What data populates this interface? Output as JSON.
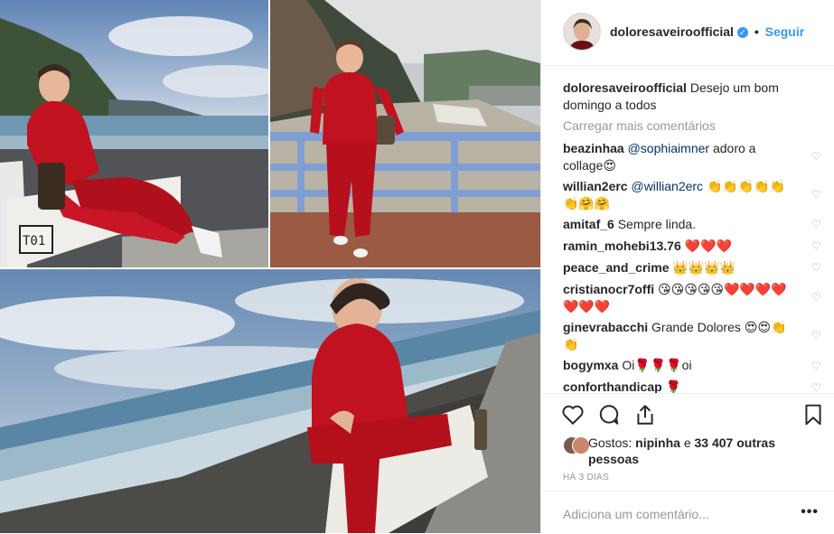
{
  "post": {
    "username": "doloresaveiroofficial",
    "verified_icon": "verified-badge-icon",
    "separator": "•",
    "follow_label": "Seguir",
    "caption_user": "doloresaveiroofficial",
    "caption_text": "Desejo um bom domingo a todos",
    "load_more": "Carregar mais comentários",
    "photo_sign": "T01",
    "comments": [
      {
        "user": "beazinhaa",
        "mention": "@sophiaimner",
        "text": "adoro a collage😍"
      },
      {
        "user": "willian2erc",
        "mention": "@willian2erc",
        "text": "👏👏👏👏👏👏🤗🤗"
      },
      {
        "user": "amitaf_6",
        "mention": "",
        "text": "Sempre linda."
      },
      {
        "user": "ramin_mohebi13.76",
        "mention": "",
        "text": "❤️❤️❤️"
      },
      {
        "user": "peace_and_crime",
        "mention": "",
        "text": "👑👑👑👑"
      },
      {
        "user": "cristianocr7offi",
        "mention": "",
        "text": "😘😘😘😘😘❤️❤️❤️❤️❤️❤️❤️"
      },
      {
        "user": "ginevrabacchi",
        "mention": "",
        "text": "Grande Dolores 😍😍👏👏"
      },
      {
        "user": "bogymxa",
        "mention": "",
        "text": "Oi🌹🌹🌹oi"
      },
      {
        "user": "conforthandicap",
        "mention": "",
        "text": "🌹"
      }
    ],
    "likes_prefix": "Gostos:",
    "likes_user": "nipinha",
    "likes_mid": "e",
    "likes_count": "33 407 outras pessoas",
    "time": "HÁ 3 DIAS",
    "add_comment_placeholder": "Adiciona um comentário...",
    "more_label": "•••"
  },
  "colors": {
    "link": "#3897f0",
    "muted": "#999999",
    "border": "#efefef",
    "tracksuit": "#c0121f"
  },
  "icons": [
    "like-heart-icon",
    "comment-icon",
    "share-icon",
    "bookmark-icon",
    "comment-like-icon"
  ]
}
